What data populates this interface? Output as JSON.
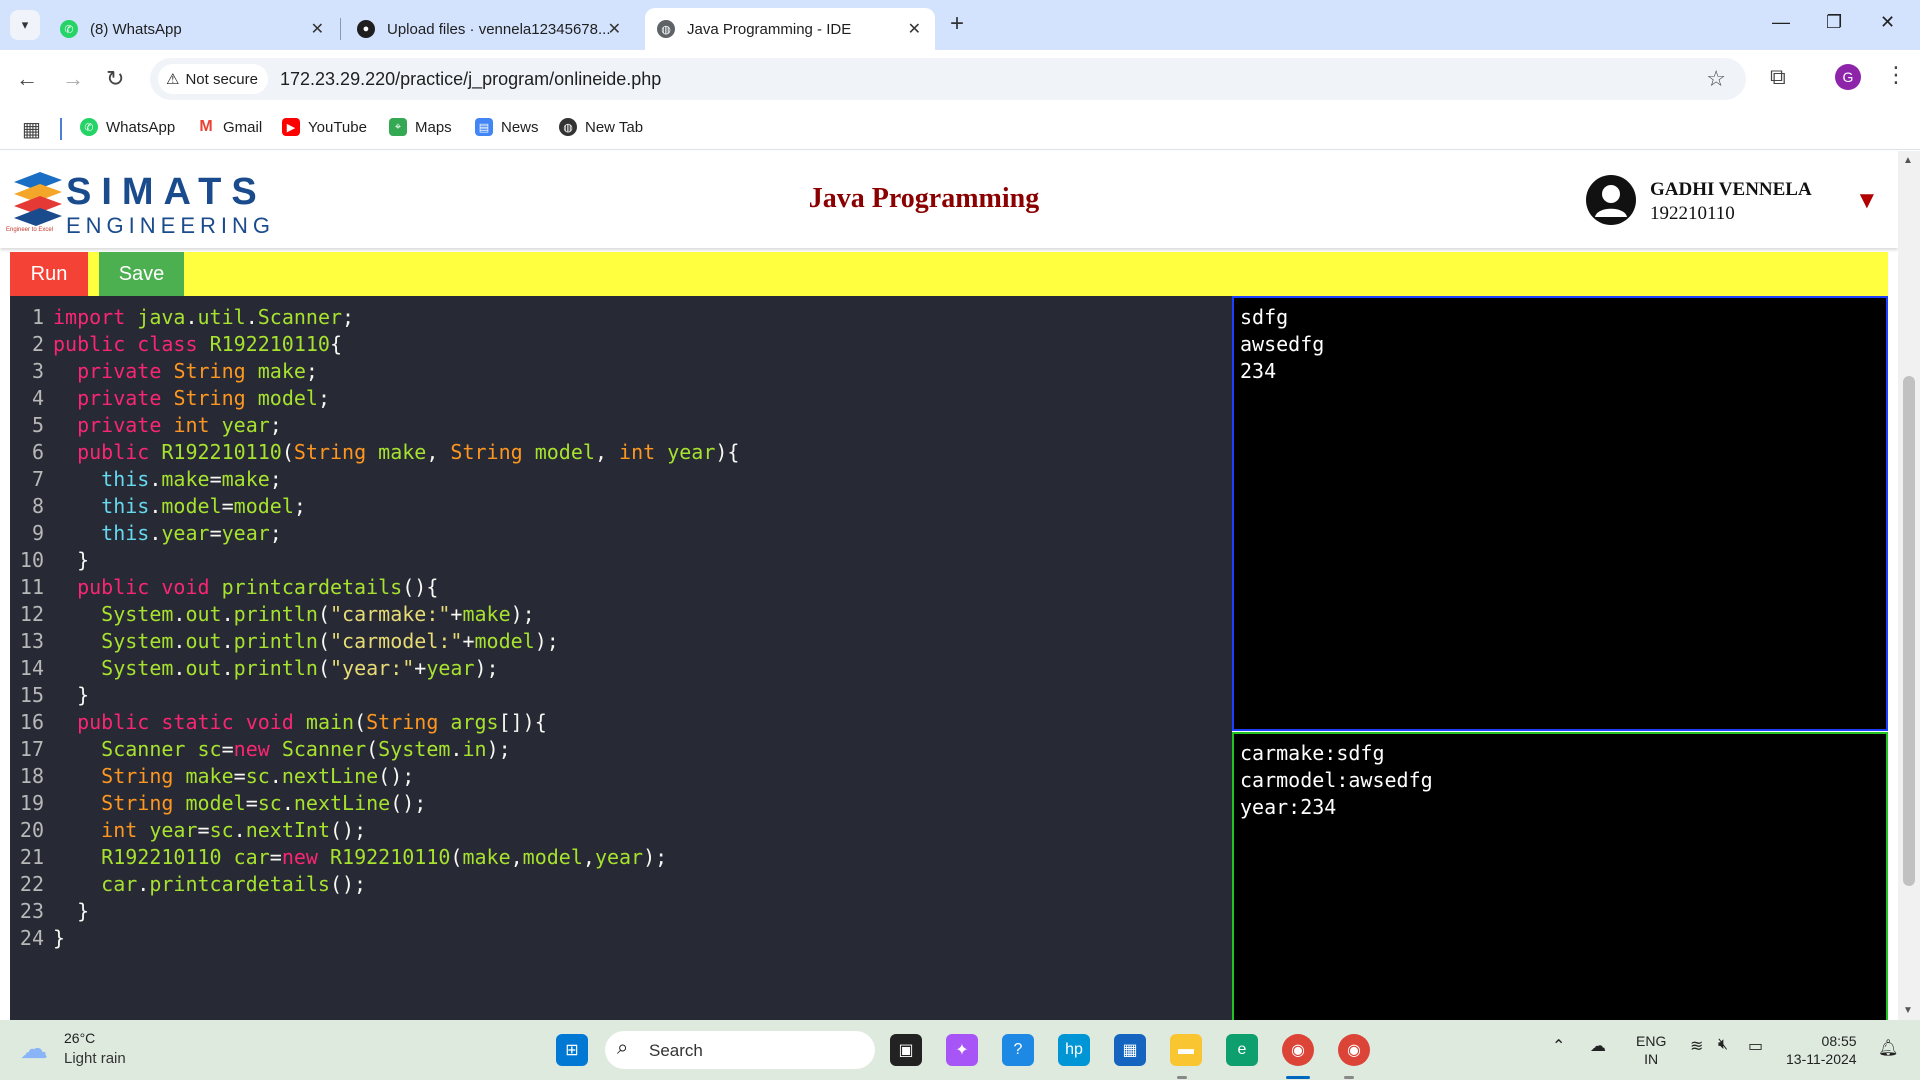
{
  "browser": {
    "tabs": [
      {
        "title": "(8) WhatsApp"
      },
      {
        "title": "Upload files · vennela12345678..."
      },
      {
        "title": "Java Programming - IDE"
      }
    ],
    "security_label": "Not secure",
    "url": "172.23.29.220/practice/j_program/onlineide.php",
    "profile_initial": "G",
    "bookmarks": [
      "WhatsApp",
      "Gmail",
      "YouTube",
      "Maps",
      "News",
      "New Tab"
    ]
  },
  "site": {
    "logo_primary": "SIMATS",
    "logo_secondary": "ENGINEERING",
    "logo_tagline": "Engineer to Excel",
    "title": "Java Programming",
    "user_name": "GADHI VENNELA",
    "user_id": "192210110"
  },
  "toolbar": {
    "run_label": "Run",
    "save_label": "Save"
  },
  "editor": {
    "lines": [
      "import java.util.Scanner;",
      "public class R192210110{",
      "  private String make;",
      "  private String model;",
      "  private int year;",
      "  public R192210110(String make, String model, int year){",
      "    this.make=make;",
      "    this.model=model;",
      "    this.year=year;",
      "  }",
      "  public void printcardetails(){",
      "    System.out.println(\"carmake:\"+make);",
      "    System.out.println(\"carmodel:\"+model);",
      "    System.out.println(\"year:\"+year);",
      "  }",
      "  public static void main(String args[]){",
      "    Scanner sc=new Scanner(System.in);",
      "    String make=sc.nextLine();",
      "    String model=sc.nextLine();",
      "    int year=sc.nextInt();",
      "    R192210110 car=new R192210110(make,model,year);",
      "    car.printcardetails();",
      "  }",
      "}"
    ]
  },
  "input_panel": {
    "lines": [
      "sdfg",
      "awsedfg",
      "234"
    ]
  },
  "output_panel": {
    "lines": [
      "carmake:sdfg",
      "carmodel:awsedfg",
      "year:234"
    ]
  },
  "taskbar": {
    "weather_temp": "26°C",
    "weather_desc": "Light rain",
    "search_placeholder": "Search",
    "lang_line1": "ENG",
    "lang_line2": "IN",
    "time": "08:55",
    "date": "13-11-2024"
  },
  "colors": {
    "run_button": "#f44336",
    "save_button": "#4caf50",
    "toolbar_bg": "#ffff3f",
    "editor_bg": "#272935",
    "title_color": "#8b0000"
  }
}
